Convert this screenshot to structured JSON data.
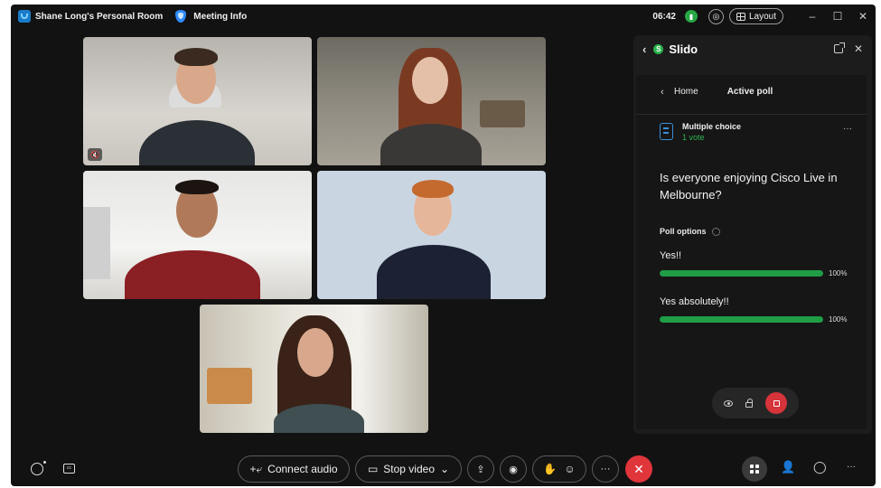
{
  "titlebar": {
    "room_name": "Shane Long's Personal Room",
    "meeting_info": "Meeting Info",
    "time": "06:42",
    "layout_label": "Layout",
    "icons": [
      "webex-logo-icon",
      "shield-icon",
      "signal-icon",
      "audio-icon",
      "layout-grid-icon",
      "minimize-icon",
      "maximize-icon",
      "close-icon"
    ]
  },
  "window_controls": {
    "minimize": "–",
    "maximize": "☐",
    "close": "✕"
  },
  "participants": [
    {
      "tile": 1,
      "muted": true,
      "mute_icon": "🔇"
    },
    {
      "tile": 2,
      "muted": false
    },
    {
      "tile": 3,
      "muted": false
    },
    {
      "tile": 4,
      "muted": false
    },
    {
      "tile": 5,
      "muted": false
    }
  ],
  "slido": {
    "title": "Slido",
    "logo_letter": "S",
    "breadcrumb_home": "Home",
    "breadcrumb_active": "Active poll",
    "poll_type": "Multiple choice",
    "votes": "1 vote",
    "question": "Is everyone enjoying Cisco Live in Melbourne?",
    "poll_options_label": "Poll options",
    "options": [
      {
        "label": "Yes!!",
        "percent": 100,
        "percent_text": "100%"
      },
      {
        "label": "Yes absolutely!!",
        "percent": 100,
        "percent_text": "100%"
      }
    ],
    "accent_color": "#1f9e45"
  },
  "controls": {
    "connect_audio": "Connect audio",
    "stop_video": "Stop video",
    "more": "···",
    "end_call": "✕"
  },
  "colors": {
    "background": "#121212",
    "panel": "#1c1c1c",
    "end_call": "#e0353b",
    "slido_green": "#2bb24c"
  }
}
